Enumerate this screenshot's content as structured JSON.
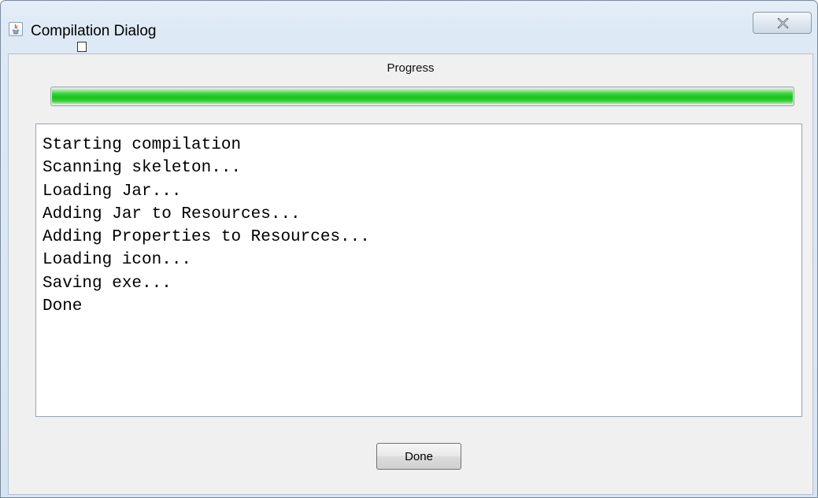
{
  "window": {
    "title": "Compilation Dialog",
    "app_icon": "java-icon",
    "close_icon": "close-icon"
  },
  "progress": {
    "label": "Progress",
    "value_percent": 100,
    "fill_color": "#18c218"
  },
  "log": {
    "lines": [
      "Starting compilation",
      "Scanning skeleton...",
      "Loading Jar...",
      "Adding Jar to Resources...",
      "Adding Properties to Resources...",
      "Loading icon...",
      "Saving exe...",
      "Done"
    ]
  },
  "buttons": {
    "done_label": "Done"
  }
}
